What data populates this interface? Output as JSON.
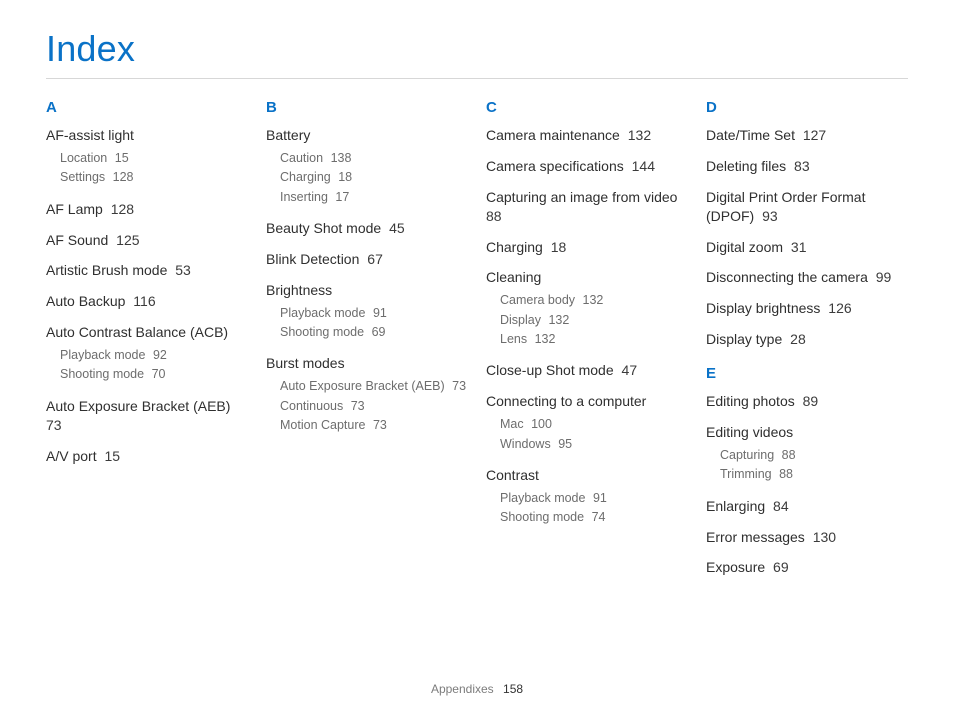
{
  "title": "Index",
  "footer": {
    "section": "Appendixes",
    "page": "158"
  },
  "index": {
    "A": [
      {
        "text": "AF-assist light",
        "subs": [
          {
            "text": "Location",
            "page": "15"
          },
          {
            "text": "Settings",
            "page": "128"
          }
        ]
      },
      {
        "text": "AF Lamp",
        "page": "128"
      },
      {
        "text": "AF Sound",
        "page": "125"
      },
      {
        "text": "Artistic Brush mode",
        "page": "53"
      },
      {
        "text": "Auto Backup",
        "page": "116"
      },
      {
        "text": "Auto Contrast Balance (ACB)",
        "subs": [
          {
            "text": "Playback mode",
            "page": "92"
          },
          {
            "text": "Shooting mode",
            "page": "70"
          }
        ]
      },
      {
        "text": "Auto Exposure Bracket (AEB)",
        "page": "73"
      },
      {
        "text": "A/V port",
        "page": "15"
      }
    ],
    "B": [
      {
        "text": "Battery",
        "subs": [
          {
            "text": "Caution",
            "page": "138"
          },
          {
            "text": "Charging",
            "page": "18"
          },
          {
            "text": "Inserting",
            "page": "17"
          }
        ]
      },
      {
        "text": "Beauty Shot mode",
        "page": "45"
      },
      {
        "text": "Blink Detection",
        "page": "67"
      },
      {
        "text": "Brightness",
        "subs": [
          {
            "text": "Playback mode",
            "page": "91"
          },
          {
            "text": "Shooting mode",
            "page": "69"
          }
        ]
      },
      {
        "text": "Burst modes",
        "subs": [
          {
            "text": "Auto Exposure Bracket (AEB)",
            "page": "73"
          },
          {
            "text": "Continuous",
            "page": "73"
          },
          {
            "text": "Motion Capture",
            "page": "73"
          }
        ]
      }
    ],
    "C": [
      {
        "text": "Camera maintenance",
        "page": "132"
      },
      {
        "text": "Camera specifications",
        "page": "144"
      },
      {
        "text": "Capturing an image from video",
        "page": "88"
      },
      {
        "text": "Charging",
        "page": "18"
      },
      {
        "text": "Cleaning",
        "subs": [
          {
            "text": "Camera body",
            "page": "132"
          },
          {
            "text": "Display",
            "page": "132"
          },
          {
            "text": "Lens",
            "page": "132"
          }
        ]
      },
      {
        "text": "Close-up Shot mode",
        "page": "47"
      },
      {
        "text": "Connecting to a computer",
        "subs": [
          {
            "text": "Mac",
            "page": "100"
          },
          {
            "text": "Windows",
            "page": "95"
          }
        ]
      },
      {
        "text": "Contrast",
        "subs": [
          {
            "text": "Playback mode",
            "page": "91"
          },
          {
            "text": "Shooting mode",
            "page": "74"
          }
        ]
      }
    ],
    "D": [
      {
        "text": "Date/Time Set",
        "page": "127"
      },
      {
        "text": "Deleting files",
        "page": "83"
      },
      {
        "text": "Digital Print Order Format (DPOF)",
        "page": "93"
      },
      {
        "text": "Digital zoom",
        "page": "31"
      },
      {
        "text": "Disconnecting the camera",
        "page": "99"
      },
      {
        "text": "Display brightness",
        "page": "126"
      },
      {
        "text": "Display type",
        "page": "28"
      }
    ],
    "E": [
      {
        "text": "Editing photos",
        "page": "89"
      },
      {
        "text": "Editing videos",
        "subs": [
          {
            "text": "Capturing",
            "page": "88"
          },
          {
            "text": "Trimming",
            "page": "88"
          }
        ]
      },
      {
        "text": "Enlarging",
        "page": "84"
      },
      {
        "text": "Error messages",
        "page": "130"
      },
      {
        "text": "Exposure",
        "page": "69"
      }
    ]
  },
  "layout": [
    [
      "A"
    ],
    [
      "B"
    ],
    [
      "C"
    ],
    [
      "D",
      "E"
    ]
  ]
}
